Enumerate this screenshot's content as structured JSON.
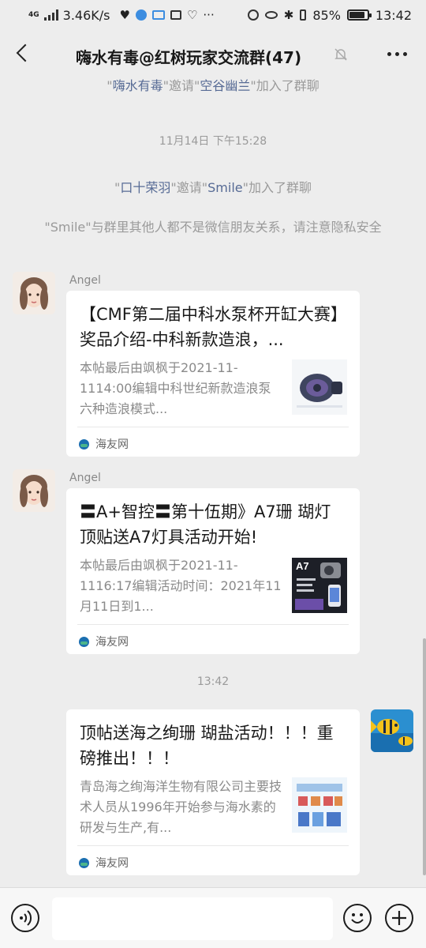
{
  "status_bar": {
    "network": "4G",
    "speed": "3.46K/s",
    "battery": "85%",
    "battery_level": 0.85,
    "time": "13:42"
  },
  "header": {
    "title": "嗨水有毒@红树玩家交流群(47)",
    "back_icon": "chevron-left-icon",
    "mute_icon": "bell-off-icon",
    "more_icon": "more-dots-icon"
  },
  "system_msgs": {
    "invite1": {
      "q1": "\"",
      "inviter": "嗨水有毒",
      "mid": "\"邀请\"",
      "invitee": "空谷幽兰",
      "tail": "\"加入了群聊"
    },
    "time1": "11月14日 下午15:28",
    "invite2": {
      "q1": "\"",
      "inviter": "口十荣羽",
      "mid": "\"邀请\"",
      "invitee": "Smile",
      "tail": "\"加入了群聊"
    },
    "warning": "\"Smile\"与群里其他人都不是微信朋友关系，请注意隐私安全",
    "time2": "13:42"
  },
  "messages": [
    {
      "sender": "Angel",
      "title": "【CMF第二届中科水泵杯开缸大赛】奖品介绍-中科新款造浪，...",
      "desc": "本帖最后由飒枫于2021-11-1114:00编辑中科世纪新款造浪泵六种造浪模式...",
      "source": "海友网"
    },
    {
      "sender": "Angel",
      "title": "〓A+智控〓第十伍期》A7珊 瑚灯顶贴送A7灯具活动开始!",
      "desc": "本帖最后由飒枫于2021-11-1116:17编辑活动时间：2021年11月11日到1...",
      "thumb_label": "A7",
      "source": "海友网"
    },
    {
      "title": "顶帖送海之绚珊 瑚盐活动！！！重磅推出！！！",
      "desc": "青岛海之绚海洋生物有限公司主要技术人员从1996年开始参与海水素的研发与生产,有...",
      "source": "海友网"
    }
  ],
  "input_bar": {
    "voice_icon": "voice-icon",
    "emoji_icon": "emoji-icon",
    "plus_icon": "plus-icon"
  }
}
